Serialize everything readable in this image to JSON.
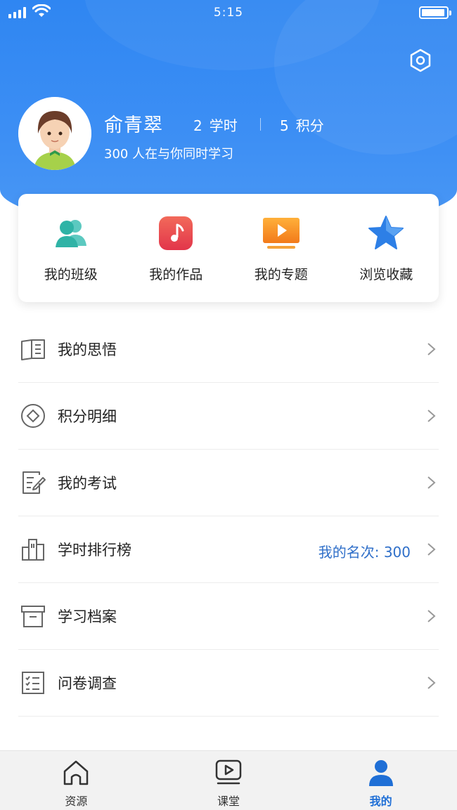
{
  "status_bar": {
    "time": "5:15"
  },
  "profile": {
    "name": "俞青翠",
    "hours_value": "2",
    "hours_unit": "学时",
    "points_value": "5",
    "points_unit": "积分",
    "online_text": "300 人在与你同时学习"
  },
  "quick_actions": [
    {
      "label": "我的班级",
      "icon": "group-icon"
    },
    {
      "label": "我的作品",
      "icon": "music-note-icon"
    },
    {
      "label": "我的专题",
      "icon": "video-screen-icon"
    },
    {
      "label": "浏览收藏",
      "icon": "star-icon"
    }
  ],
  "menu": [
    {
      "label": "我的思悟",
      "icon": "book-icon",
      "extra": ""
    },
    {
      "label": "积分明细",
      "icon": "points-diamond-icon",
      "extra": ""
    },
    {
      "label": "我的考试",
      "icon": "exam-edit-icon",
      "extra": ""
    },
    {
      "label": "学时排行榜",
      "icon": "ranking-building-icon",
      "extra": "我的名次: 300"
    },
    {
      "label": "学习档案",
      "icon": "archive-box-icon",
      "extra": ""
    },
    {
      "label": "问卷调查",
      "icon": "checklist-icon",
      "extra": ""
    }
  ],
  "tabs": [
    {
      "label": "资源",
      "icon": "home-icon",
      "active": false
    },
    {
      "label": "课堂",
      "icon": "play-screen-icon",
      "active": false
    },
    {
      "label": "我的",
      "icon": "person-icon",
      "active": true
    }
  ],
  "colors": {
    "header_blue": "#2f86f2",
    "accent_text": "#2f6fc9",
    "active_tab": "#1f6fd6"
  }
}
